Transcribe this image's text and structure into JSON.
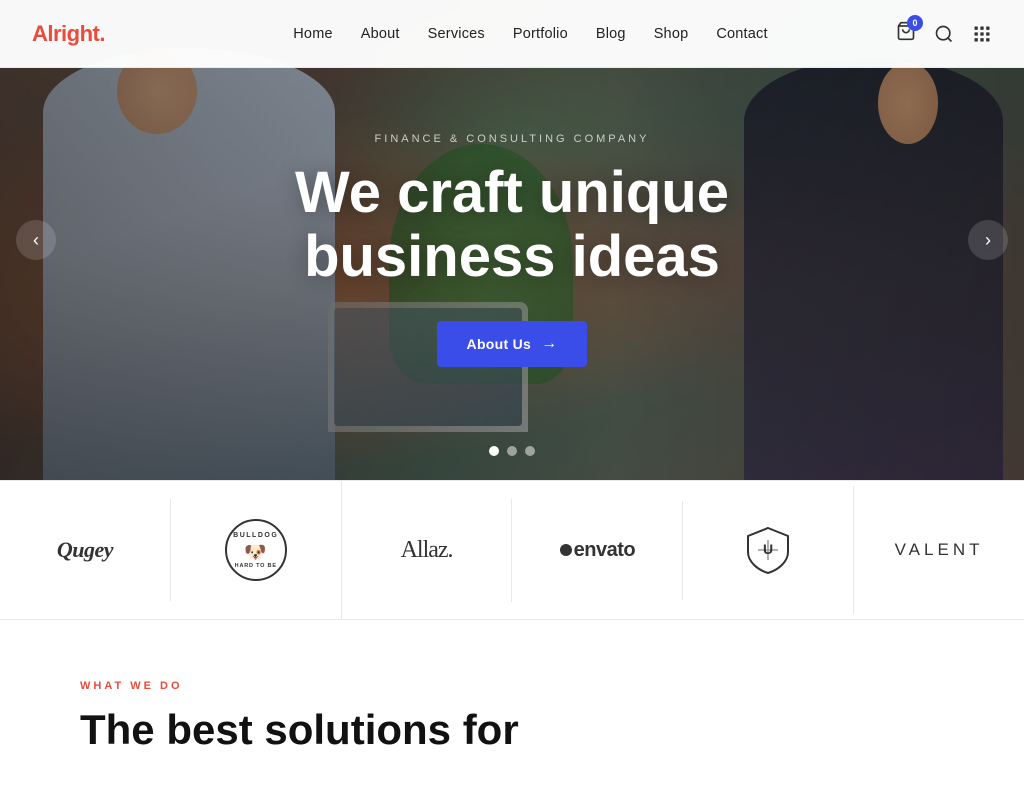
{
  "site": {
    "logo_text": "Alright",
    "logo_dot": ".",
    "cart_badge": "0"
  },
  "nav": {
    "items": [
      {
        "label": "Home",
        "href": "#"
      },
      {
        "label": "About",
        "href": "#"
      },
      {
        "label": "Services",
        "href": "#"
      },
      {
        "label": "Portfolio",
        "href": "#"
      },
      {
        "label": "Blog",
        "href": "#"
      },
      {
        "label": "Shop",
        "href": "#"
      },
      {
        "label": "Contact",
        "href": "#"
      }
    ]
  },
  "hero": {
    "subtitle": "Finance & Consulting Company",
    "title_line1": "We craft unique",
    "title_line2": "business ideas",
    "cta_label": "About Us",
    "dots": [
      true,
      false,
      false
    ]
  },
  "brands": [
    {
      "name": "Qugey",
      "style": "normal"
    },
    {
      "name": "BULLDOG",
      "style": "badge",
      "sub": "HARD TO BE"
    },
    {
      "name": "Allaz.",
      "style": "serif"
    },
    {
      "name": "envato",
      "style": "dot-prefix"
    },
    {
      "name": "shield",
      "style": "icon"
    },
    {
      "name": "VALENT",
      "style": "thin"
    }
  ],
  "what_we_do": {
    "label": "What We Do",
    "title_line1": "The best solutions for"
  }
}
